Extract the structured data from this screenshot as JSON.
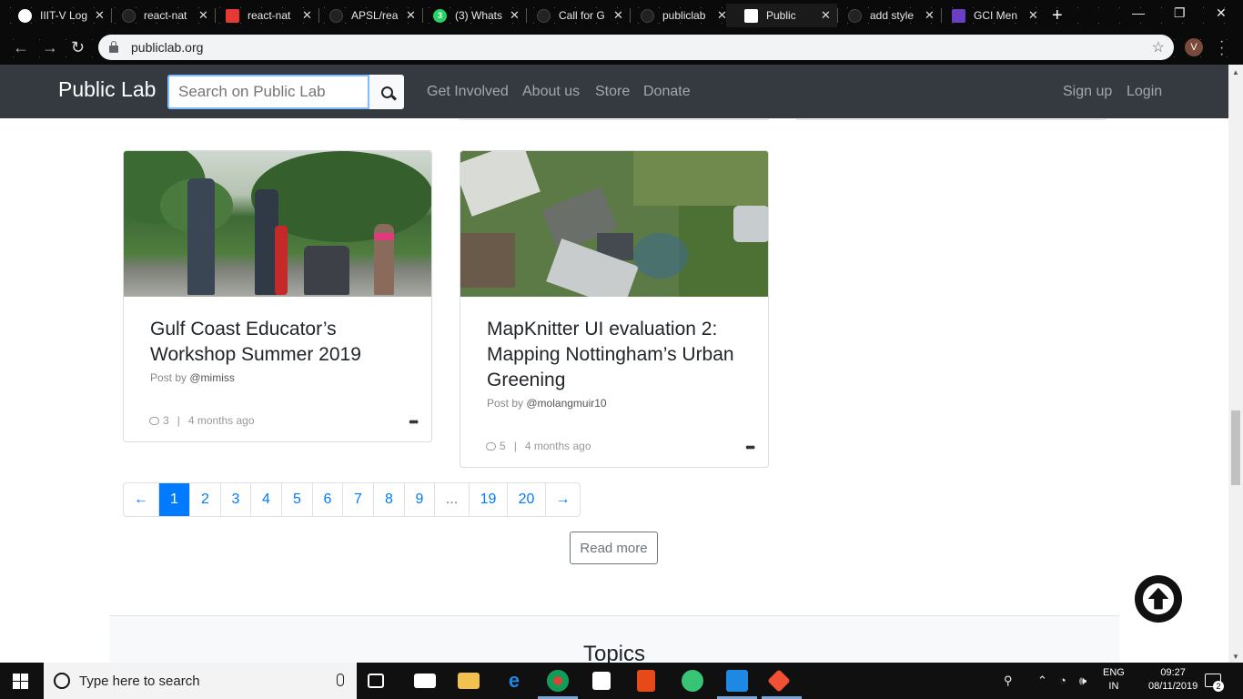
{
  "browser": {
    "tabs": [
      {
        "title": "IIIT-V Log",
        "icon_color": "#ffffff"
      },
      {
        "title": "react-nat",
        "icon_color": "#333333"
      },
      {
        "title": "react-nat",
        "icon_color": "#e53935"
      },
      {
        "title": "APSL/rea",
        "icon_color": "#333333"
      },
      {
        "title": "(3) Whats",
        "icon_color": "#25d366"
      },
      {
        "title": "Call for G",
        "icon_color": "#333333"
      },
      {
        "title": "publiclab",
        "icon_color": "#333333"
      },
      {
        "title": "Public",
        "icon_color": "#ffffff"
      },
      {
        "title": "add style",
        "icon_color": "#333333"
      },
      {
        "title": "GCI Men",
        "icon_color": "#6a3fc4"
      }
    ],
    "url": "publiclab.org",
    "profile_initial": "V"
  },
  "site": {
    "brand": "Public Lab",
    "search_placeholder": "Search on Public Lab",
    "nav": [
      "Get Involved",
      "About us",
      "Store",
      "Donate"
    ],
    "auth": [
      "Sign up",
      "Login"
    ]
  },
  "cards": [
    {
      "title": "Gulf Coast Educator’s Workshop Summer 2019",
      "post_by_label": "Post by",
      "author": "@mimiss",
      "comments": "3",
      "separator": "|",
      "age": "4 months ago",
      "more": "•••"
    },
    {
      "title": "MapKnitter UI evaluation 2: Mapping Nottingham’s Urban Greening",
      "post_by_label": "Post by",
      "author": "@molangmuir10",
      "comments": "5",
      "separator": "|",
      "age": "4 months ago",
      "more": "•••"
    }
  ],
  "pagination": {
    "prev": "←",
    "pages": [
      "1",
      "2",
      "3",
      "4",
      "5",
      "6",
      "7",
      "8",
      "9",
      "...",
      "19",
      "20"
    ],
    "active": "1",
    "next": "→"
  },
  "read_more": "Read more",
  "topics_heading": "Topics",
  "taskbar": {
    "search_placeholder": "Type here to search",
    "lang_top": "ENG",
    "lang_bottom": "IN",
    "time": "09:27",
    "date": "08/11/2019",
    "notifications": "2"
  },
  "colors": {
    "navbar": "#343a40",
    "link": "#007bff",
    "active_page": "#007bff"
  }
}
